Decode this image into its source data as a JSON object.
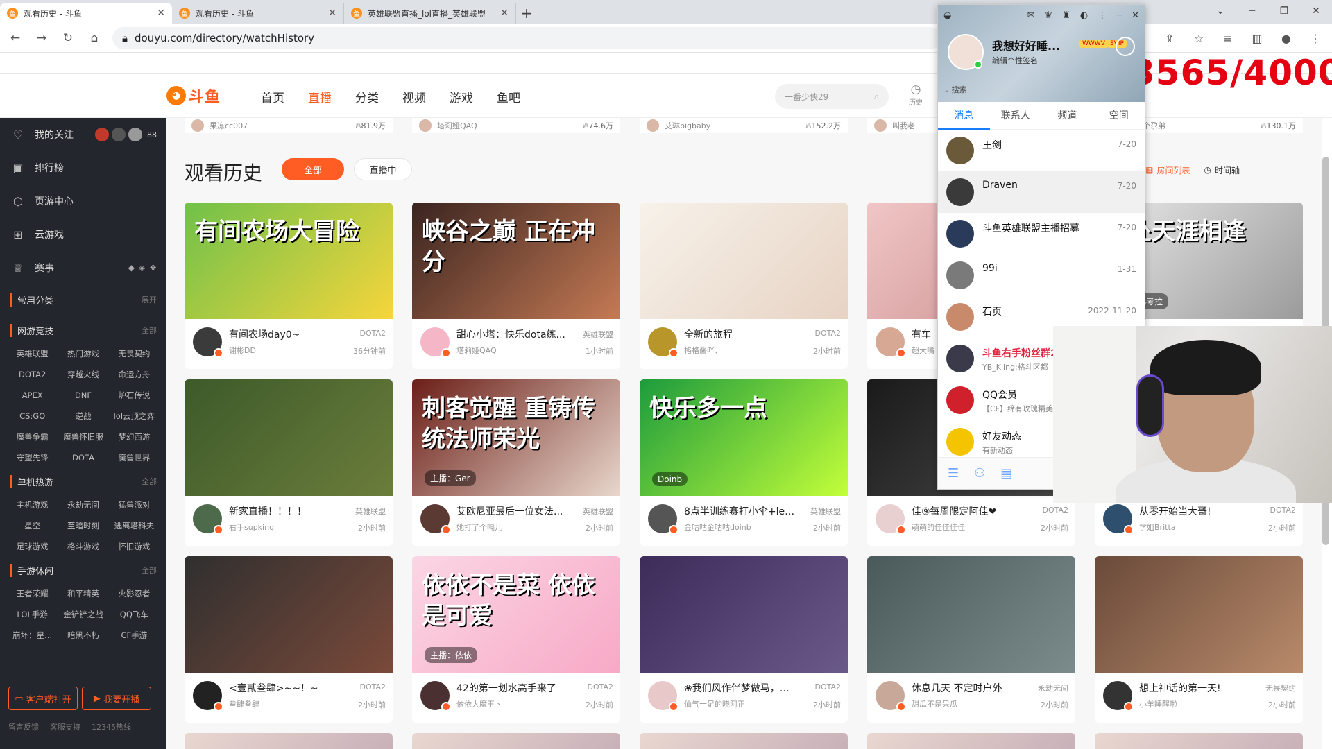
{
  "browser": {
    "tabs": [
      {
        "title": "观看历史 - 斗鱼",
        "active": true
      },
      {
        "title": "观看历史 - 斗鱼",
        "active": false
      },
      {
        "title": "英雄联盟直播_lol直播_英雄联盟",
        "active": false
      }
    ],
    "new_tab": "+",
    "url": "douyu.com/directory/watchHistory"
  },
  "header": {
    "logo_text": "斗鱼",
    "nav": [
      "首页",
      "直播",
      "分类",
      "视频",
      "游戏",
      "鱼吧"
    ],
    "active_nav": "直播",
    "search_placeholder": "一番少侠29",
    "history_label": "历史"
  },
  "sidebar": {
    "main_items": [
      {
        "label": "我的关注",
        "icon": "heart-icon",
        "follow_count": "88"
      },
      {
        "label": "排行榜",
        "icon": "rank-icon"
      },
      {
        "label": "页游中心",
        "icon": "shield-icon"
      },
      {
        "label": "云游戏",
        "icon": "gamepad-icon"
      },
      {
        "label": "赛事",
        "icon": "trophy-icon"
      }
    ],
    "sections": [
      {
        "title": "常用分类",
        "more": "展开",
        "items": []
      },
      {
        "title": "网游竞技",
        "more": "全部",
        "items": [
          "英雄联盟",
          "热门游戏",
          "无畏契约",
          "DOTA2",
          "穿越火线",
          "命运方舟",
          "APEX",
          "DNF",
          "炉石传说",
          "CS:GO",
          "逆战",
          "lol云顶之弈",
          "魔兽争霸",
          "魔兽怀旧服",
          "梦幻西游",
          "守望先锋",
          "DOTA",
          "魔兽世界"
        ]
      },
      {
        "title": "单机热游",
        "more": "全部",
        "items": [
          "主机游戏",
          "永劫无间",
          "猛兽派对",
          "星空",
          "至暗时刻",
          "逃离塔科夫",
          "足球游戏",
          "格斗游戏",
          "怀旧游戏"
        ]
      },
      {
        "title": "手游休闲",
        "more": "全部",
        "items": [
          "王者荣耀",
          "和平精英",
          "火影忍者",
          "LOL手游",
          "金铲铲之战",
          "QQ飞车",
          "崩坏：星...",
          "暗黑不朽",
          "CF手游"
        ]
      }
    ],
    "btn_client": "客户端打开",
    "btn_live": "我要开播",
    "links": [
      "留言反馈",
      "客服支持",
      "12345热线"
    ]
  },
  "main": {
    "top_row": [
      {
        "host": "果冻cc007",
        "hot": "81.9万"
      },
      {
        "host": "塔莉娅QAQ",
        "hot": "74.6万"
      },
      {
        "host": "艾琳bigbaby",
        "hot": "152.2万"
      },
      {
        "host": "叫我老",
        "hot": ""
      },
      {
        "host": "小果是个尕弟",
        "hot": "130.1万"
      }
    ],
    "page_title": "观看历史",
    "filter_all": "全部",
    "filter_live": "直播中",
    "view_history_cut": "史",
    "view_room_list": "房间列表",
    "view_timeline": "时间轴",
    "cards": [
      {
        "caption": "有间农场大冒险",
        "subcap": "",
        "title": "有间农场day0~",
        "cat": "DOTA2",
        "host": "谢彬DD",
        "time": "36分钟前",
        "c1": "#6fc14a",
        "c2": "#f6d53b",
        "av": "#3b3b3b"
      },
      {
        "caption": "峡谷之巅 正在冲分",
        "subcap": "",
        "title": "甜心小塔：快乐dota练...",
        "cat": "英雄联盟",
        "host": "塔莉娅QAQ",
        "time": "1小时前",
        "c1": "#3a2420",
        "c2": "#c57a54",
        "av": "#f5b6c8"
      },
      {
        "caption": "",
        "subcap": "",
        "title": "全新的旅程",
        "cat": "DOTA2",
        "host": "格格酱吖、",
        "time": "2小时前",
        "c1": "#f7f2ea",
        "c2": "#e7d3c4",
        "av": "#b9962a"
      },
      {
        "caption": "",
        "subcap": "",
        "title": "有车",
        "cat": "",
        "host": "超大嘴",
        "time": "",
        "c1": "#f1c6c6",
        "c2": "#c98c8c",
        "av": "#d7a995"
      },
      {
        "caption": "何处天涯相逢",
        "subcap": "汐溪是小考拉",
        "title": "",
        "cat": "",
        "host": "",
        "time": "",
        "c1": "#e8e8e8",
        "c2": "#9b9b9b",
        "av": "#ccc"
      },
      {
        "caption": "",
        "subcap": "",
        "title": "新家直播！！！！",
        "cat": "英雄联盟",
        "host": "右手supking",
        "time": "2小时前",
        "c1": "#3d5a2a",
        "c2": "#6b7d3b",
        "av": "#4d6a4a"
      },
      {
        "caption": "刺客觉醒 重铸传统法师荣光",
        "subcap": "主播：Ger",
        "title": "艾欧尼亚最后一位女法...",
        "cat": "英雄联盟",
        "host": "她打了个嗝儿",
        "time": "2小时前",
        "c1": "#6b1f18",
        "c2": "#e9d7cc",
        "av": "#5a3a32"
      },
      {
        "caption": "快乐多一点",
        "subcap": "Doinb",
        "title": "8点半训练赛打小伞+let...",
        "cat": "英雄联盟",
        "host": "金咕咕金咕咕doinb",
        "time": "2小时前",
        "c1": "#1c9b3c",
        "c2": "#c3ff3a",
        "av": "#555"
      },
      {
        "caption": "",
        "subcap": "",
        "title": "佳⑨每周限定阿佳❤",
        "cat": "DOTA2",
        "host": "萌萌的佳佳佳佳",
        "time": "2小时前",
        "c1": "#1a1a1a",
        "c2": "#4a4a4a",
        "av": "#e8d0d0"
      },
      {
        "caption": "",
        "subcap": "",
        "title": "从零开始当大哥!",
        "cat": "DOTA2",
        "host": "学姐Britta",
        "time": "2小时前",
        "c1": "#303030",
        "c2": "#555",
        "av": "#2f4f6f"
      },
      {
        "caption": "",
        "subcap": "",
        "title": "<壹贰叁肆>~~！~",
        "cat": "DOTA2",
        "host": "叁肆叁肆",
        "time": "2小时前",
        "c1": "#2f2f2f",
        "c2": "#7a4a3a",
        "av": "#222"
      },
      {
        "caption": "依依不是菜 依依是可爱",
        "subcap": "主播：依依",
        "title": "42的第一划水高手来了",
        "cat": "DOTA2",
        "host": "依依大魔王丶",
        "time": "2小时前",
        "c1": "#fbd6e4",
        "c2": "#f7a9c6",
        "av": "#4a3030"
      },
      {
        "caption": "",
        "subcap": "",
        "title": "❀我们风作伴梦做马，追...",
        "cat": "DOTA2",
        "host": "仙气十足的晓阿正",
        "time": "2小时前",
        "c1": "#3d2b5a",
        "c2": "#6a5a8a",
        "av": "#e8c8c8"
      },
      {
        "caption": "",
        "subcap": "",
        "title": "休息几天 不定时户外",
        "cat": "永劫无间",
        "host": "甜瓜不是呆瓜",
        "time": "2小时前",
        "c1": "#4a5a5a",
        "c2": "#7c8c8c",
        "av": "#c8a898"
      },
      {
        "caption": "",
        "subcap": "",
        "title": "想上神话的第一天!",
        "cat": "无畏契约",
        "host": "小羊睡醒啦",
        "time": "2小时前",
        "c1": "#6a4a3a",
        "c2": "#b88a6a",
        "av": "#333"
      }
    ]
  },
  "overlay_counter": "3565/4000",
  "qq": {
    "name": "我想好好睡...",
    "badge1": "WWWV",
    "badge2": "SVIP",
    "signature": "编辑个性签名",
    "search": "搜索",
    "tabs": [
      "消息",
      "联系人",
      "频道",
      "空间"
    ],
    "items": [
      {
        "name": "王剑",
        "sub": "",
        "date": "7-20",
        "color": "#6a5a3a",
        "red": false
      },
      {
        "name": "Draven",
        "sub": "",
        "date": "7-20",
        "color": "#3a3a3a",
        "red": false
      },
      {
        "name": "斗鱼英雄联盟主播招募",
        "sub": "",
        "date": "7-20",
        "color": "#2a3a5a",
        "red": false
      },
      {
        "name": "99i",
        "sub": "",
        "date": "1-31",
        "color": "#7a7a7a",
        "red": false
      },
      {
        "name": "石页",
        "sub": "",
        "date": "2022-11-20",
        "color": "#c88a6a",
        "red": false
      },
      {
        "name": "斗鱼右手粉丝群2",
        "sub": "YB_Kling:格斗区都",
        "date": "",
        "color": "#3a3a4a",
        "red": true
      },
      {
        "name": "QQ会员",
        "sub": "【CF】缔有玫瑰精美",
        "date": "",
        "color": "#d0202b",
        "red": false
      },
      {
        "name": "好友动态",
        "sub": "有新动态",
        "date": "",
        "color": "#f5c400",
        "red": false
      }
    ]
  },
  "colors": {
    "accent": "#ff5d23",
    "sidebar": "#23262c",
    "qq_blue": "#1a7dff",
    "counter": "#e50012"
  }
}
